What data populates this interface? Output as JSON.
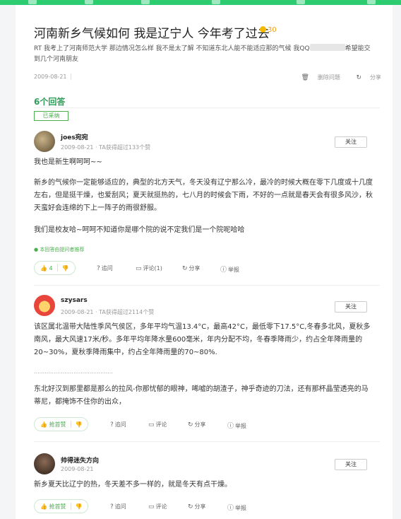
{
  "question": {
    "title": "河南新乡气候如何 我是辽宁人 今年考了过去",
    "reward": "30",
    "desc_part1": "RT 我考上了河南师范大学 那边情况怎么样 我不是太了解 不知道东北人能不能适应那的气候 我QQ",
    "desc_part2": "希望能交到几个河南朋友",
    "date": "2009-08-21",
    "actions": {
      "delete": "删除问题",
      "share": "分享"
    }
  },
  "answers_count": "6个回答",
  "adopted_tag": "已采纳",
  "answers": [
    {
      "username": "joes宛宛",
      "meta": "2009-08-21 · TA获得超过133个赞",
      "follow": "关注",
      "paragraphs": [
        "我也是新生啊呵呵~~",
        "新乡的气候你一定能够适应的，典型的北方天气，冬天没有辽宁那么冷，最冷的时候大概在零下几度或十几度左右，但是挺干燥，也爱刮风；夏天就挺热的，七八月的时候会下雨，不好的一点就是春天会有很多风沙，秋天蛮好会连绵的下上一阵子的雨很舒服。",
        "我们是校友哈~呵呵不知道你是哪个院的说不定我们是一个院呢哈哈"
      ],
      "recommend": "本回答由提问者推荐",
      "likes": "4",
      "actions": {
        "ask": "追问",
        "comment": "评论(1)",
        "share": "分享",
        "report": "举报"
      }
    },
    {
      "username": "szysars",
      "meta": "2009-08-21 · TA获得超过2114个赞",
      "follow": "关注",
      "paragraphs": [
        "该区属北温带大陆性季风气侯区，多年平均气温13.4°C，最高42°C，最低零下17.5°C,冬春多北风，夏秋多南风，最大风速17米/秒。多年平均年降水量600毫米，年内分配不均，冬春季降雨少，约占全年降雨量的20~30%，夏秋季降雨集中，约占全年降雨量的70~80%.",
        "............................................",
        "东北好汉到那里都是那么的拉风-你那忧郁的眼神，唏嘘的胡渣子，神乎奇迹的刀法，还有那杯晶莹透亮的马蒂尼，都掩饰不住你的出众，"
      ],
      "likes": "抢首赞",
      "actions": {
        "ask": "追问",
        "comment": "评论",
        "share": "分享",
        "report": "举报"
      }
    },
    {
      "username": "帅得迷失方向",
      "meta": "2009-08-21",
      "follow": "关注",
      "paragraphs": [
        "新乡夏天比辽宁的热，冬天差不多一样的，就是冬天有点干燥。"
      ],
      "likes": "抢首赞",
      "actions": {
        "ask": "追问",
        "comment": "评论",
        "share": "分享",
        "report": "举报"
      }
    }
  ],
  "colors": {
    "accent": "#2e9c58",
    "topbar": "#2ecc71",
    "reward": "#f39c12"
  },
  "icons": [
    "coin-icon",
    "delete-icon",
    "share-icon",
    "verified-icon",
    "thumb-up-icon",
    "thumb-down-icon",
    "question-icon",
    "comment-icon",
    "report-icon"
  ]
}
